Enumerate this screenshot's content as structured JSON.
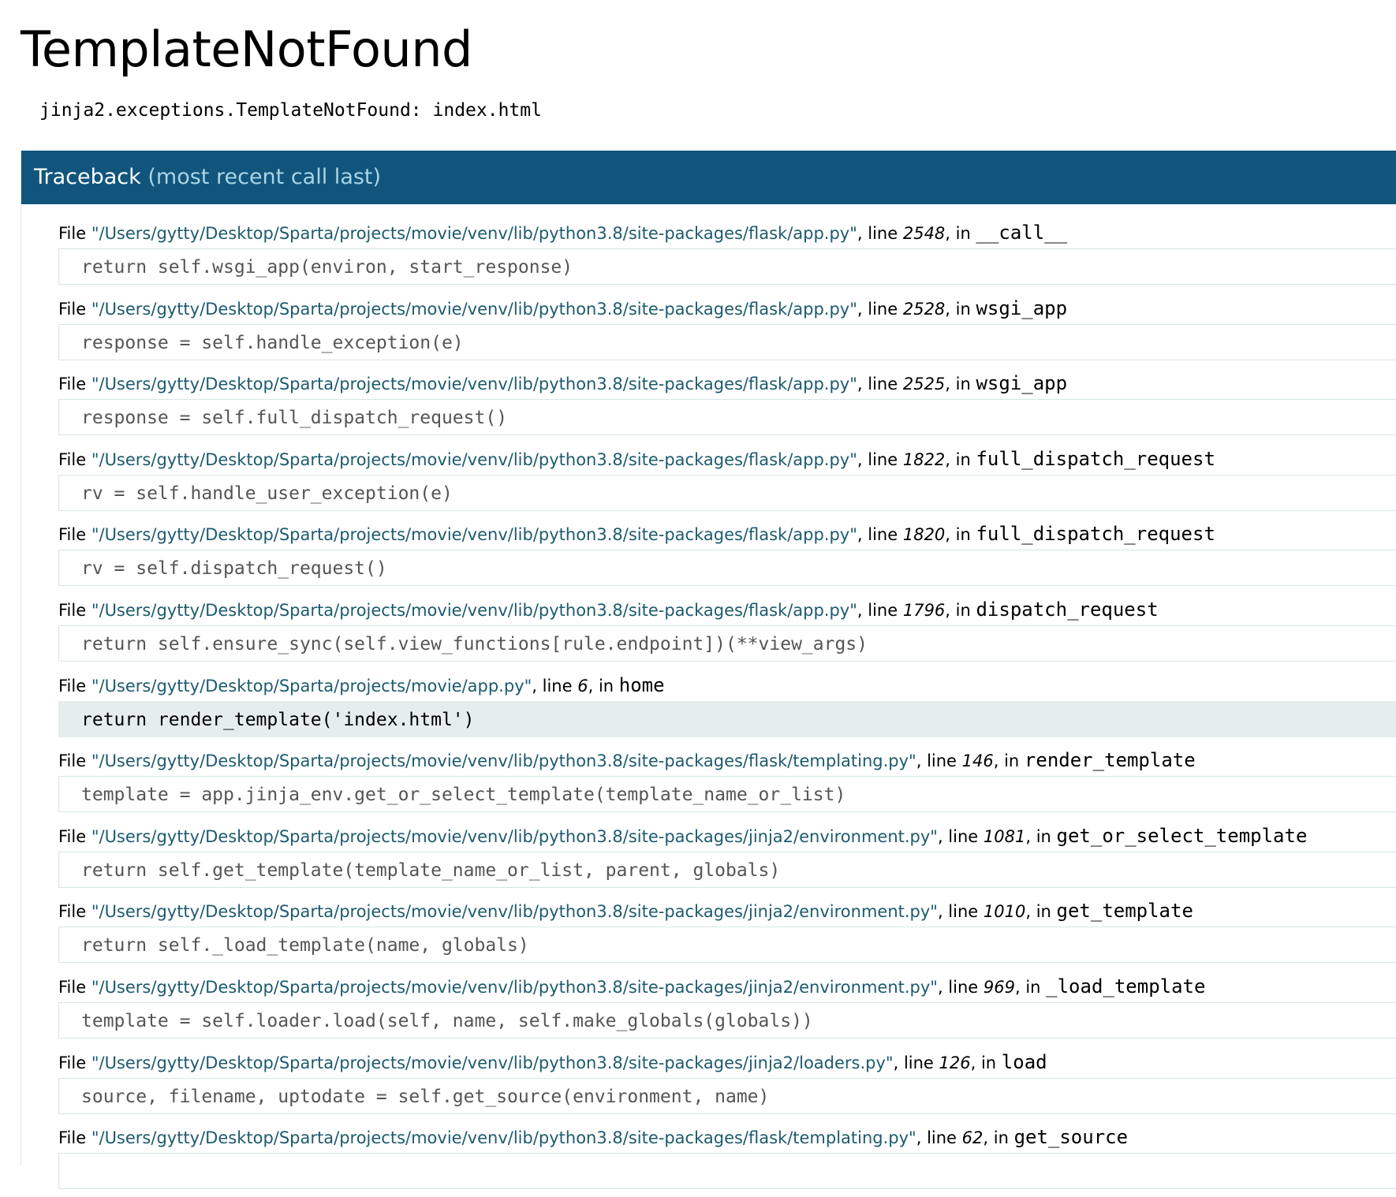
{
  "page": {
    "title": "TemplateNotFound",
    "error_message": "jinja2.exceptions.TemplateNotFound: index.html"
  },
  "traceback": {
    "header_main": "Traceback",
    "header_sub": "(most recent call last)",
    "frames": [
      {
        "file": "\"/Users/gytty/Desktop/Sparta/projects/movie/venv/lib/python3.8/site-packages/flask/app.py\"",
        "line": "2548",
        "func": "__call__",
        "source": "return self.wsgi_app(environ, start_response)",
        "current": false
      },
      {
        "file": "\"/Users/gytty/Desktop/Sparta/projects/movie/venv/lib/python3.8/site-packages/flask/app.py\"",
        "line": "2528",
        "func": "wsgi_app",
        "source": "response = self.handle_exception(e)",
        "current": false
      },
      {
        "file": "\"/Users/gytty/Desktop/Sparta/projects/movie/venv/lib/python3.8/site-packages/flask/app.py\"",
        "line": "2525",
        "func": "wsgi_app",
        "source": "response = self.full_dispatch_request()",
        "current": false
      },
      {
        "file": "\"/Users/gytty/Desktop/Sparta/projects/movie/venv/lib/python3.8/site-packages/flask/app.py\"",
        "line": "1822",
        "func": "full_dispatch_request",
        "source": "rv = self.handle_user_exception(e)",
        "current": false
      },
      {
        "file": "\"/Users/gytty/Desktop/Sparta/projects/movie/venv/lib/python3.8/site-packages/flask/app.py\"",
        "line": "1820",
        "func": "full_dispatch_request",
        "source": "rv = self.dispatch_request()",
        "current": false
      },
      {
        "file": "\"/Users/gytty/Desktop/Sparta/projects/movie/venv/lib/python3.8/site-packages/flask/app.py\"",
        "line": "1796",
        "func": "dispatch_request",
        "source": "return self.ensure_sync(self.view_functions[rule.endpoint])(**view_args)",
        "current": false
      },
      {
        "file": "\"/Users/gytty/Desktop/Sparta/projects/movie/app.py\"",
        "line": "6",
        "func": "home",
        "source": "return render_template('index.html')",
        "current": true
      },
      {
        "file": "\"/Users/gytty/Desktop/Sparta/projects/movie/venv/lib/python3.8/site-packages/flask/templating.py\"",
        "line": "146",
        "func": "render_template",
        "source": "template = app.jinja_env.get_or_select_template(template_name_or_list)",
        "current": false
      },
      {
        "file": "\"/Users/gytty/Desktop/Sparta/projects/movie/venv/lib/python3.8/site-packages/jinja2/environment.py\"",
        "line": "1081",
        "func": "get_or_select_template",
        "source": "return self.get_template(template_name_or_list, parent, globals)",
        "current": false
      },
      {
        "file": "\"/Users/gytty/Desktop/Sparta/projects/movie/venv/lib/python3.8/site-packages/jinja2/environment.py\"",
        "line": "1010",
        "func": "get_template",
        "source": "return self._load_template(name, globals)",
        "current": false
      },
      {
        "file": "\"/Users/gytty/Desktop/Sparta/projects/movie/venv/lib/python3.8/site-packages/jinja2/environment.py\"",
        "line": "969",
        "func": "_load_template",
        "source": "template = self.loader.load(self, name, self.make_globals(globals))",
        "current": false
      },
      {
        "file": "\"/Users/gytty/Desktop/Sparta/projects/movie/venv/lib/python3.8/site-packages/jinja2/loaders.py\"",
        "line": "126",
        "func": "load",
        "source": "source, filename, uptodate = self.get_source(environment, name)",
        "current": false
      },
      {
        "file": "\"/Users/gytty/Desktop/Sparta/projects/movie/venv/lib/python3.8/site-packages/flask/templating.py\"",
        "line": "62",
        "func": "get_source",
        "source": "",
        "current": false
      }
    ]
  },
  "labels": {
    "file": "File ",
    "line_sep": ", line ",
    "in_sep": ", in "
  },
  "colors": {
    "header_bg": "#11557c",
    "header_sub": "#a8d4e6",
    "filename": "#1d5a6e",
    "current_line_bg": "#e6eded"
  }
}
